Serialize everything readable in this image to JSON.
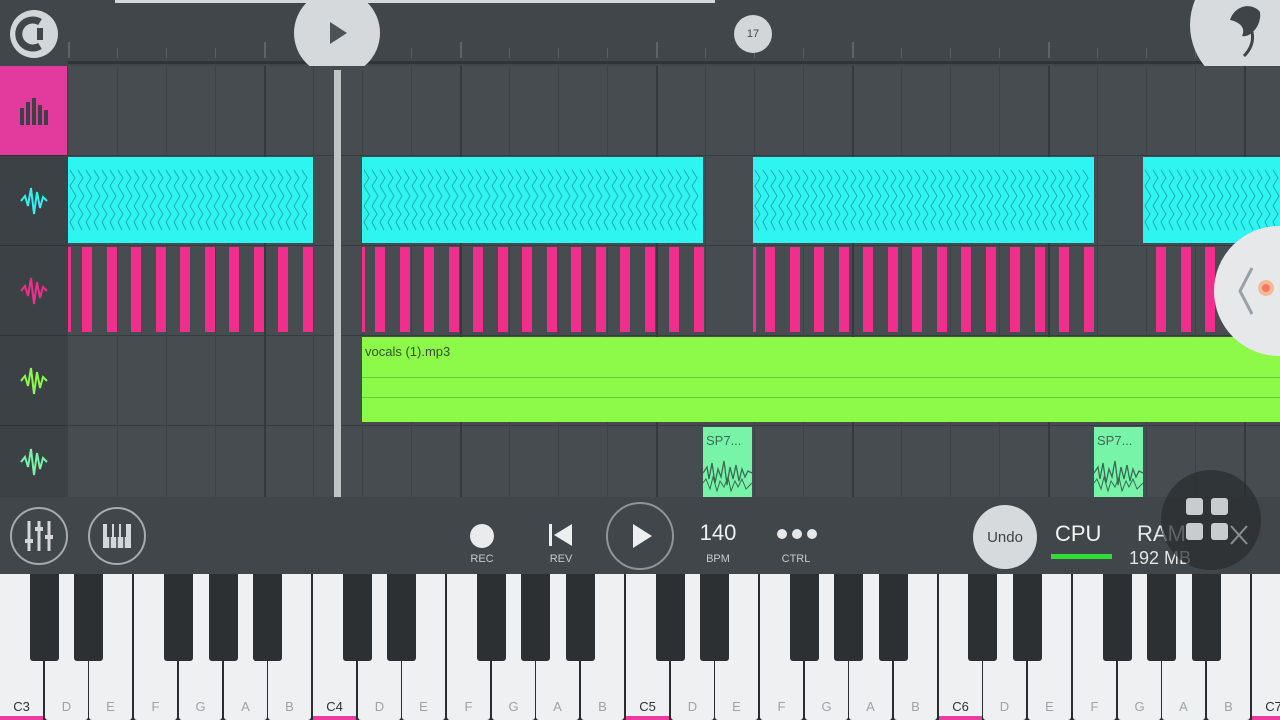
{
  "timeline": {
    "marker_label": "17"
  },
  "clips": {
    "vocals_label": "vocals (1).mp3",
    "sp_label_1": "SP7...",
    "sp_label_2": "SP7..."
  },
  "transport": {
    "rec_label": "REC",
    "rev_label": "REV",
    "bpm_value": "140",
    "bpm_label": "BPM",
    "ctrl_label": "CTRL",
    "undo_label": "Undo",
    "cpu_label": "CPU",
    "ram_label": "RAM",
    "ram_value": "192 MB"
  },
  "keyboard": {
    "white_keys": [
      "C3",
      "D",
      "E",
      "F",
      "G",
      "A",
      "B",
      "C4",
      "D",
      "E",
      "F",
      "G",
      "A",
      "B",
      "C5",
      "D",
      "E",
      "F",
      "G",
      "A",
      "B",
      "C6",
      "D",
      "E",
      "F",
      "G",
      "A",
      "B",
      "C7"
    ]
  },
  "colors": {
    "accent": "#e33a9d",
    "cyan_clip": "#2ef5ef",
    "pink_clip": "#f02f8c",
    "vocals_clip": "#8dfa4a",
    "sample_clip": "#77f4a8",
    "cpu_meter": "#2fdc3a"
  }
}
